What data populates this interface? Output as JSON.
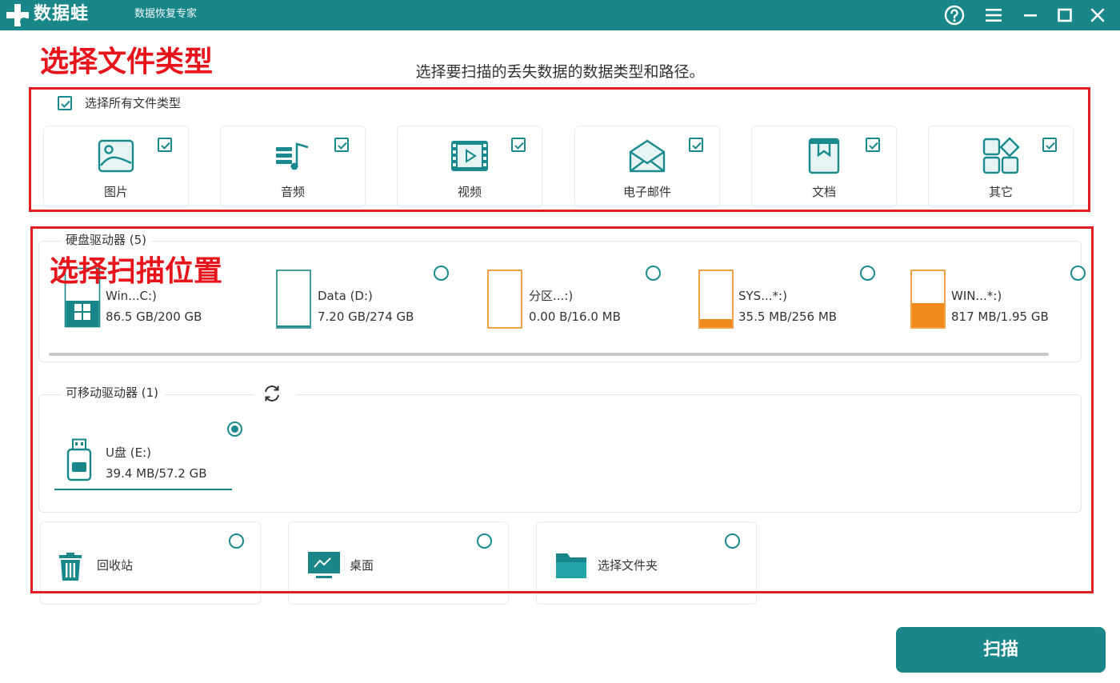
{
  "app": {
    "brand": "数据蛙",
    "tagline": "数据恢复专家",
    "accent_color": "#19868a",
    "window_controls": [
      "help-icon",
      "menu-icon",
      "minimize-icon",
      "maximize-icon",
      "close-icon"
    ]
  },
  "annotations": {
    "select_file_types": "选择文件类型",
    "select_scan_location": "选择扫描位置",
    "highlight_color": "#e31b23"
  },
  "subtitle": "选择要扫描的丢失数据的数据类型和路径。",
  "file_types": {
    "select_all_label": "选择所有文件类型",
    "select_all_checked": true,
    "items": [
      {
        "label": "图片",
        "icon": "image-icon",
        "checked": true
      },
      {
        "label": "音频",
        "icon": "audio-icon",
        "checked": true
      },
      {
        "label": "视频",
        "icon": "video-icon",
        "checked": true
      },
      {
        "label": "电子邮件",
        "icon": "email-icon",
        "checked": true
      },
      {
        "label": "文档",
        "icon": "document-icon",
        "checked": true
      },
      {
        "label": "其它",
        "icon": "other-icon",
        "checked": true
      }
    ]
  },
  "hard_drives": {
    "title": "硬盘驱动器 (5)",
    "items": [
      {
        "name": "Win...C:)",
        "size": "86.5 GB/200 GB",
        "icon": "windows-drive-icon",
        "fill_fraction": 0.43,
        "fill_color": "#19868a"
      },
      {
        "name": "Data (D:)",
        "size": "7.20 GB/274 GB",
        "icon": "drive-icon",
        "fill_fraction": 0.03,
        "fill_color": "#19868a"
      },
      {
        "name": "分区...:)",
        "size": "0.00  B/16.0 MB",
        "icon": "drive-icon",
        "fill_fraction": 0.0,
        "fill_color": "#f08a1c"
      },
      {
        "name": "SYS...*:)",
        "size": "35.5 MB/256 MB",
        "icon": "drive-icon",
        "fill_fraction": 0.14,
        "fill_color": "#f08a1c"
      },
      {
        "name": "WIN...*:)",
        "size": "817 MB/1.95 GB",
        "icon": "drive-icon",
        "fill_fraction": 0.42,
        "fill_color": "#f08a1c"
      }
    ]
  },
  "removable_drives": {
    "title": "可移动驱动器 (1)",
    "refresh_icon": "refresh-icon",
    "items": [
      {
        "name": "U盘 (E:)",
        "size": "39.4 MB/57.2 GB",
        "icon": "usb-drive-icon",
        "selected": true
      }
    ]
  },
  "locations": [
    {
      "label": "回收站",
      "icon": "recycle-bin-icon"
    },
    {
      "label": "桌面",
      "icon": "desktop-icon"
    },
    {
      "label": "选择文件夹",
      "icon": "folder-icon"
    }
  ],
  "scan_button": "扫描"
}
